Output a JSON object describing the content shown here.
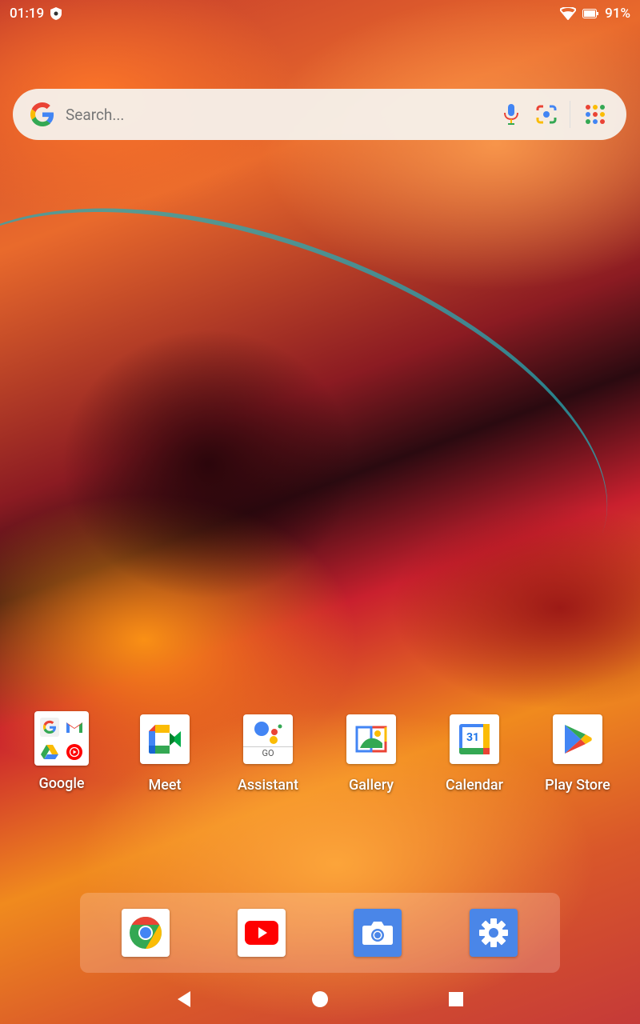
{
  "status_bar": {
    "time": "01:19",
    "battery": "91%"
  },
  "search": {
    "placeholder": "Search..."
  },
  "apps": [
    {
      "label": "Google"
    },
    {
      "label": "Meet"
    },
    {
      "label": "Assistant"
    },
    {
      "label": "Gallery"
    },
    {
      "label": "Calendar"
    },
    {
      "label": "Play Store"
    }
  ],
  "calendar_day": "31",
  "assistant_badge": "GO",
  "colors": {
    "google_blue": "#4285F4",
    "google_red": "#EA4335",
    "google_yellow": "#FBBC05",
    "google_green": "#34A853",
    "youtube_red": "#FF0000"
  }
}
